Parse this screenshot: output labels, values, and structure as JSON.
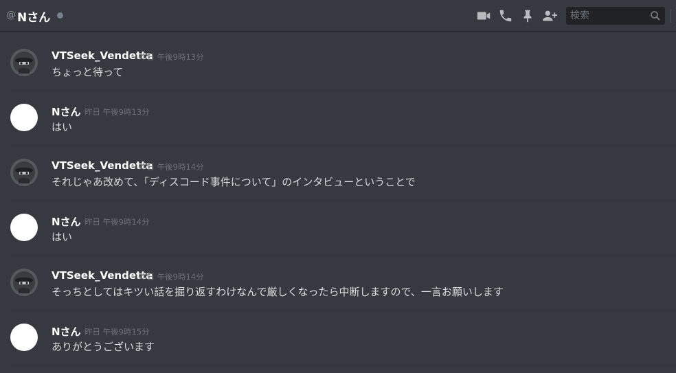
{
  "header": {
    "at_symbol": "@",
    "title": "Nさん",
    "search_placeholder": "検索"
  },
  "icons": {
    "video": "video-call-icon",
    "phone": "voice-call-icon",
    "pin": "pin-icon",
    "add_user": "add-friend-icon",
    "search": "search-icon"
  },
  "colors": {
    "background": "#36393f",
    "status_offline": "#747f8d"
  },
  "messages": [
    {
      "author": "VTSeek_Vendetta",
      "timestamp": "昨日 午後9時13分",
      "text": "ちょっと待って"
    },
    {
      "author": "Nさん",
      "timestamp": "昨日 午後9時13分",
      "text": "はい"
    },
    {
      "author": "VTSeek_Vendetta",
      "timestamp": "昨日 午後9時14分",
      "text": "それじゃあ改めて、「ディスコード事件について」のインタビューということで"
    },
    {
      "author": "Nさん",
      "timestamp": "昨日 午後9時14分",
      "text": "はい"
    },
    {
      "author": "VTSeek_Vendetta",
      "timestamp": "昨日 午後9時14分",
      "text": "そっちとしてはキツい話を掘り返すわけなんで厳しくなったら中断しますので、一言お願いします"
    },
    {
      "author": "Nさん",
      "timestamp": "昨日 午後9時15分",
      "text": "ありがとうございます"
    }
  ]
}
